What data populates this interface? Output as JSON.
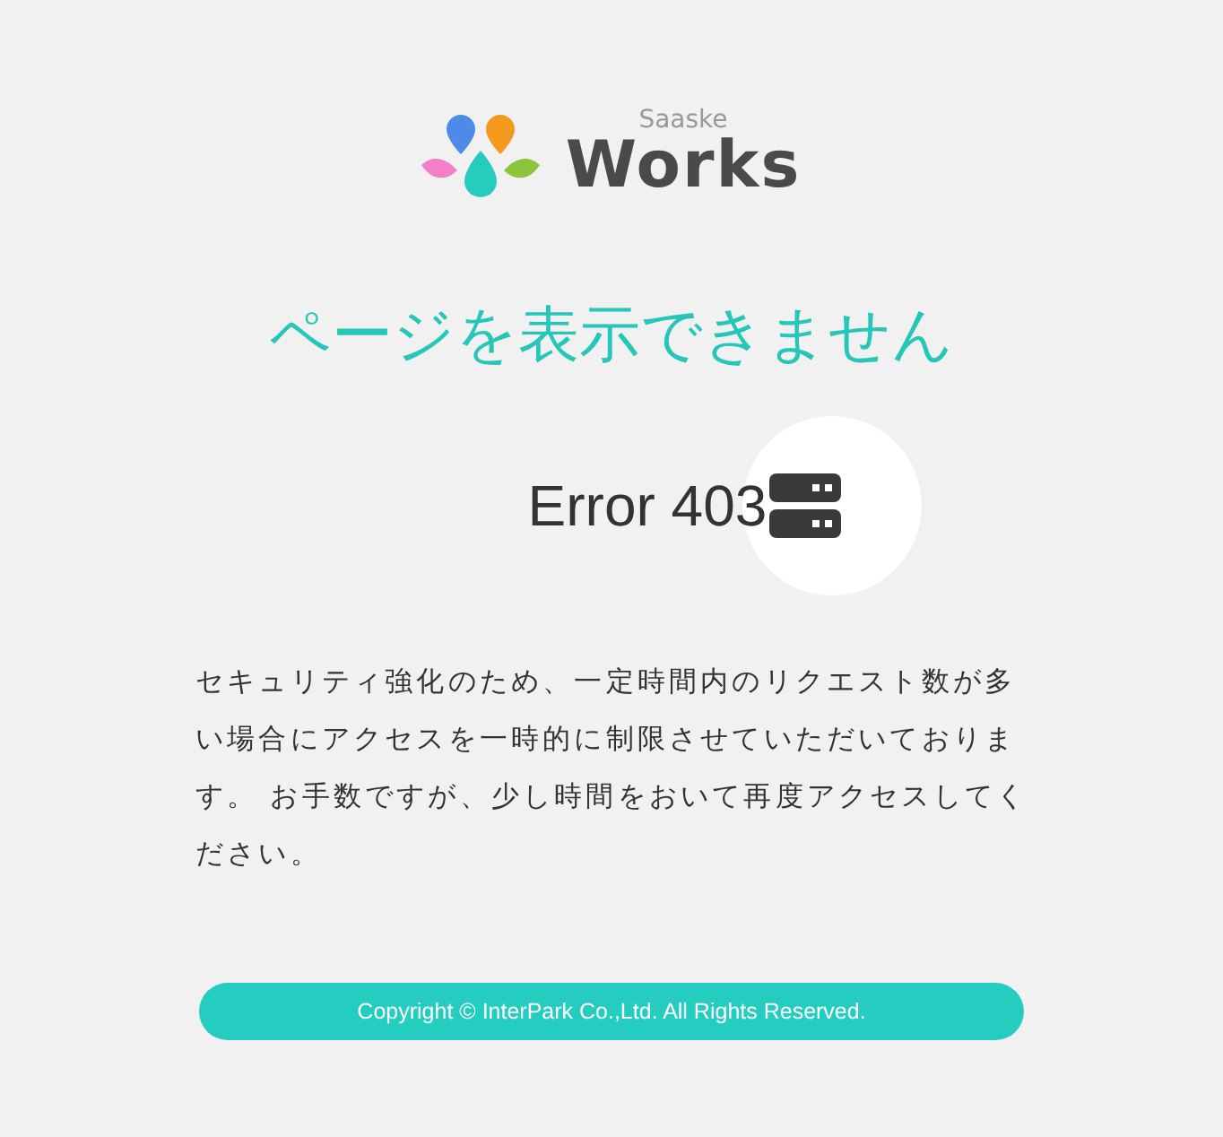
{
  "logo": {
    "subtitle": "Saaske",
    "name": "Works"
  },
  "heading": "ページを表示できません",
  "error": {
    "code": "Error 403"
  },
  "message": "セキュリティ強化のため、一定時間内のリクエスト数が多い場合にアクセスを一時的に制限させていただいております。 お手数ですが、少し時間をおいて再度アクセスしてください。",
  "footer": {
    "copyright": "Copyright © InterPark Co.,Ltd. All Rights Reserved."
  }
}
